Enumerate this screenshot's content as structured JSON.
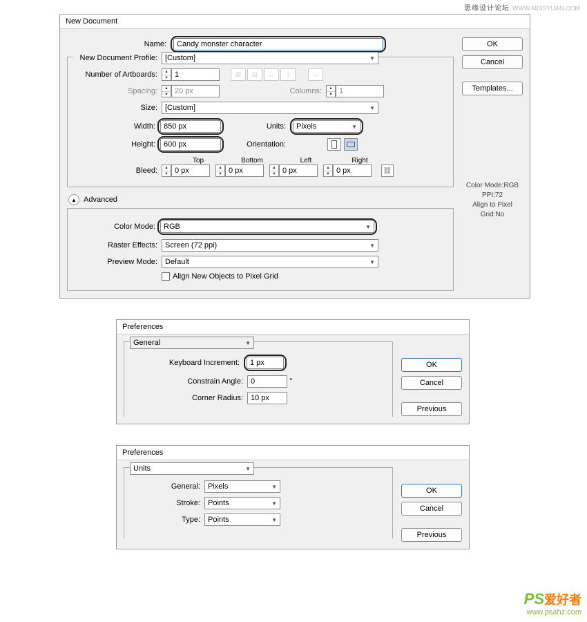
{
  "topCredit": {
    "text": "思缘设计论坛",
    "domain": "WWW.MISSYUAN.COM"
  },
  "dlg1": {
    "title": "New Document",
    "buttons": {
      "ok": "OK",
      "cancel": "Cancel",
      "templates": "Templates..."
    },
    "labels": {
      "name": "Name:",
      "profile": "New Document Profile:",
      "artboards": "Number of Artboards:",
      "spacing": "Spacing:",
      "columns": "Columns:",
      "size": "Size:",
      "width": "Width:",
      "height": "Height:",
      "units": "Units:",
      "orientation": "Orientation:",
      "bleed": "Bleed:",
      "top": "Top",
      "bottom": "Bottom",
      "left": "Left",
      "right": "Right",
      "advanced": "Advanced",
      "colorMode": "Color Mode:",
      "raster": "Raster Effects:",
      "preview": "Preview Mode:",
      "align": "Align New Objects to Pixel Grid"
    },
    "values": {
      "name": "Candy monster character",
      "profile": "[Custom]",
      "artboards": "1",
      "spacing": "20 px",
      "columns": "1",
      "size": "[Custom]",
      "width": "850 px",
      "height": "600 px",
      "units": "Pixels",
      "bleedTop": "0 px",
      "bleedBottom": "0 px",
      "bleedLeft": "0 px",
      "bleedRight": "0 px",
      "colorMode": "RGB",
      "raster": "Screen (72 ppi)",
      "preview": "Default"
    },
    "info": {
      "l1": "Color Mode:RGB",
      "l2": "PPI:72",
      "l3": "Align to Pixel Grid:No"
    }
  },
  "dlg2": {
    "title": "Preferences",
    "tab": "General",
    "buttons": {
      "ok": "OK",
      "cancel": "Cancel",
      "previous": "Previous"
    },
    "labels": {
      "kbd": "Keyboard Increment:",
      "angle": "Constrain Angle:",
      "corner": "Corner Radius:"
    },
    "values": {
      "kbd": "1 px",
      "angle": "0",
      "corner": "10 px"
    }
  },
  "dlg3": {
    "title": "Preferences",
    "tab": "Units",
    "buttons": {
      "ok": "OK",
      "cancel": "Cancel",
      "previous": "Previous"
    },
    "labels": {
      "general": "General:",
      "stroke": "Stroke:",
      "type": "Type:"
    },
    "values": {
      "general": "Pixels",
      "stroke": "Points",
      "type": "Points"
    }
  },
  "watermark": {
    "ps": "PS",
    "cn": "爱好者",
    "url": "www.psahz.com"
  }
}
